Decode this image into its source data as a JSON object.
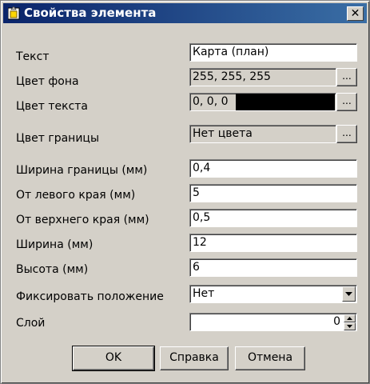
{
  "window": {
    "title": "Свойства элемента",
    "close_label": "✕"
  },
  "properties": [
    {
      "label": "Текст",
      "value": "Карта (план)"
    },
    {
      "label": "Цвет фона",
      "value": "255, 255, 255",
      "button": "..."
    },
    {
      "label": "Цвет текста",
      "value": "0, 0, 0",
      "button": "...",
      "swatch_color": "#000000"
    },
    {
      "label": "Цвет границы",
      "value": "Нет цвета",
      "button": "..."
    },
    {
      "label": "Ширина границы (мм)",
      "value": "0,4"
    },
    {
      "label": "От левого края (мм)",
      "value": "5"
    },
    {
      "label": "От верхнего края (мм)",
      "value": "0,5"
    },
    {
      "label": "Ширина (мм)",
      "value": "12"
    },
    {
      "label": "Высота (мм)",
      "value": "6"
    },
    {
      "label": "Фиксировать положение",
      "value": "Нет"
    },
    {
      "label": "Слой",
      "value": "0"
    }
  ],
  "buttons": {
    "ok": "OK",
    "help": "Справка",
    "cancel": "Отмена"
  }
}
